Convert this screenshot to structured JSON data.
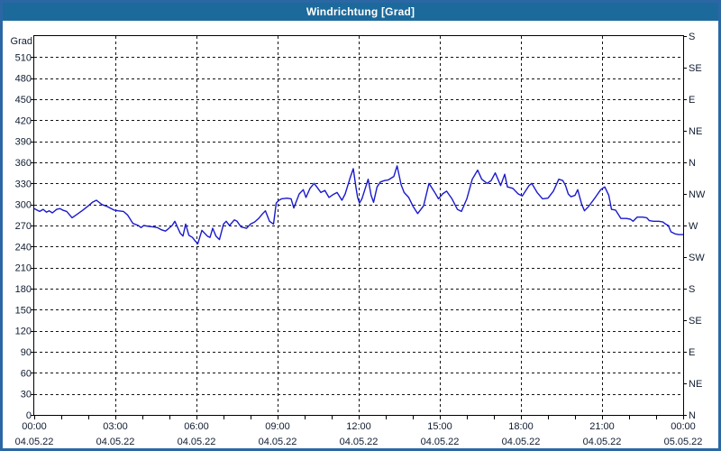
{
  "window": {
    "title": "Windrichtung [Grad]"
  },
  "colors": {
    "titlebar_bg": "#1c6a9c",
    "titlebar_text": "#ffffff",
    "frame": "#2b67a5",
    "background": "#ffffff",
    "plot_border": "#000000",
    "grid": "#141414",
    "axis_text": "#101c30",
    "line": "#1a1acc"
  },
  "chart_data": {
    "type": "line",
    "title": "Windrichtung [Grad]",
    "ylabel": "Grad",
    "ylim": [
      0,
      540
    ],
    "xlim_hours": [
      0,
      24
    ],
    "grid": "dashed",
    "y_ticks": [
      0,
      30,
      60,
      90,
      120,
      150,
      180,
      210,
      240,
      270,
      300,
      330,
      360,
      390,
      420,
      450,
      480,
      510
    ],
    "right_ticks": [
      {
        "value": 0,
        "label": "N"
      },
      {
        "value": 45,
        "label": "NE"
      },
      {
        "value": 90,
        "label": "E"
      },
      {
        "value": 135,
        "label": "SE"
      },
      {
        "value": 180,
        "label": "S"
      },
      {
        "value": 225,
        "label": "SW"
      },
      {
        "value": 270,
        "label": "W"
      },
      {
        "value": 315,
        "label": "NW"
      },
      {
        "value": 360,
        "label": "N"
      },
      {
        "value": 405,
        "label": "NE"
      },
      {
        "value": 450,
        "label": "E"
      },
      {
        "value": 495,
        "label": "SE"
      },
      {
        "value": 540,
        "label": "S"
      }
    ],
    "x_ticks": [
      {
        "hour": 0,
        "time": "00:00",
        "date": "04.05.22"
      },
      {
        "hour": 3,
        "time": "03:00",
        "date": "04.05.22"
      },
      {
        "hour": 6,
        "time": "06:00",
        "date": "04.05.22"
      },
      {
        "hour": 9,
        "time": "09:00",
        "date": "04.05.22"
      },
      {
        "hour": 12,
        "time": "12:00",
        "date": "04.05.22"
      },
      {
        "hour": 15,
        "time": "15:00",
        "date": "04.05.22"
      },
      {
        "hour": 18,
        "time": "18:00",
        "date": "04.05.22"
      },
      {
        "hour": 21,
        "time": "21:00",
        "date": "04.05.22"
      },
      {
        "hour": 24,
        "time": "00:00",
        "date": "05.05.22"
      }
    ],
    "minor_x_tick_hours": 1,
    "series": [
      {
        "name": "Windrichtung",
        "points": [
          [
            0,
            294
          ],
          [
            0.1,
            292
          ],
          [
            0.2,
            290
          ],
          [
            0.33,
            293
          ],
          [
            0.45,
            289
          ],
          [
            0.55,
            291
          ],
          [
            0.67,
            288
          ],
          [
            0.83,
            293
          ],
          [
            0.95,
            294
          ],
          [
            1.05,
            292
          ],
          [
            1.2,
            290
          ],
          [
            1.4,
            281
          ],
          [
            1.55,
            285
          ],
          [
            1.8,
            292
          ],
          [
            2,
            298
          ],
          [
            2.15,
            303
          ],
          [
            2.3,
            306
          ],
          [
            2.5,
            300
          ],
          [
            2.7,
            297
          ],
          [
            2.95,
            292
          ],
          [
            3.1,
            291
          ],
          [
            3.3,
            290
          ],
          [
            3.45,
            285
          ],
          [
            3.65,
            273
          ],
          [
            3.85,
            270
          ],
          [
            3.95,
            267
          ],
          [
            4.05,
            270
          ],
          [
            4.2,
            269
          ],
          [
            4.4,
            268
          ],
          [
            4.55,
            267
          ],
          [
            4.7,
            264
          ],
          [
            4.85,
            262
          ],
          [
            4.95,
            265
          ],
          [
            5.1,
            270
          ],
          [
            5.2,
            276
          ],
          [
            5.4,
            259
          ],
          [
            5.5,
            255
          ],
          [
            5.6,
            272
          ],
          [
            5.72,
            256
          ],
          [
            5.85,
            253
          ],
          [
            5.95,
            248
          ],
          [
            6.05,
            244
          ],
          [
            6.2,
            263
          ],
          [
            6.4,
            255
          ],
          [
            6.5,
            253
          ],
          [
            6.6,
            266
          ],
          [
            6.72,
            255
          ],
          [
            6.85,
            250
          ],
          [
            7,
            272
          ],
          [
            7.1,
            276
          ],
          [
            7.22,
            270
          ],
          [
            7.4,
            278
          ],
          [
            7.5,
            276
          ],
          [
            7.65,
            268
          ],
          [
            7.85,
            266
          ],
          [
            8,
            272
          ],
          [
            8.15,
            275
          ],
          [
            8.3,
            280
          ],
          [
            8.45,
            287
          ],
          [
            8.55,
            291
          ],
          [
            8.7,
            276
          ],
          [
            8.85,
            272
          ],
          [
            8.95,
            302
          ],
          [
            9.05,
            306
          ],
          [
            9.15,
            308
          ],
          [
            9.35,
            309
          ],
          [
            9.5,
            308
          ],
          [
            9.6,
            295
          ],
          [
            9.8,
            315
          ],
          [
            9.95,
            321
          ],
          [
            10.05,
            310
          ],
          [
            10.2,
            323
          ],
          [
            10.35,
            330
          ],
          [
            10.45,
            325
          ],
          [
            10.6,
            317
          ],
          [
            10.75,
            320
          ],
          [
            10.9,
            310
          ],
          [
            11.05,
            314
          ],
          [
            11.2,
            317
          ],
          [
            11.38,
            306
          ],
          [
            11.5,
            315
          ],
          [
            11.62,
            330
          ],
          [
            11.7,
            340
          ],
          [
            11.8,
            351
          ],
          [
            11.9,
            324
          ],
          [
            11.96,
            310
          ],
          [
            12.03,
            302
          ],
          [
            12.12,
            308
          ],
          [
            12.35,
            336
          ],
          [
            12.46,
            313
          ],
          [
            12.55,
            303
          ],
          [
            12.68,
            325
          ],
          [
            12.8,
            332
          ],
          [
            12.95,
            334
          ],
          [
            13.1,
            335
          ],
          [
            13.3,
            340
          ],
          [
            13.42,
            355
          ],
          [
            13.57,
            328
          ],
          [
            13.68,
            317
          ],
          [
            13.85,
            310
          ],
          [
            14,
            298
          ],
          [
            14.18,
            287
          ],
          [
            14.4,
            298
          ],
          [
            14.6,
            330
          ],
          [
            14.8,
            318
          ],
          [
            14.95,
            308
          ],
          [
            15.1,
            315
          ],
          [
            15.25,
            319
          ],
          [
            15.45,
            308
          ],
          [
            15.65,
            293
          ],
          [
            15.8,
            290
          ],
          [
            16,
            308
          ],
          [
            16.2,
            336
          ],
          [
            16.4,
            349
          ],
          [
            16.55,
            336
          ],
          [
            16.75,
            330
          ],
          [
            16.9,
            334
          ],
          [
            17.05,
            345
          ],
          [
            17.25,
            327
          ],
          [
            17.4,
            343
          ],
          [
            17.5,
            325
          ],
          [
            17.7,
            323
          ],
          [
            17.9,
            315
          ],
          [
            18.05,
            312
          ],
          [
            18.3,
            327
          ],
          [
            18.4,
            330
          ],
          [
            18.6,
            317
          ],
          [
            18.8,
            308
          ],
          [
            19,
            309
          ],
          [
            19.2,
            319
          ],
          [
            19.4,
            336
          ],
          [
            19.55,
            334
          ],
          [
            19.65,
            327
          ],
          [
            19.75,
            315
          ],
          [
            19.85,
            311
          ],
          [
            20,
            313
          ],
          [
            20.1,
            321
          ],
          [
            20.25,
            300
          ],
          [
            20.35,
            291
          ],
          [
            20.5,
            297
          ],
          [
            20.75,
            310
          ],
          [
            20.95,
            321
          ],
          [
            21.1,
            325
          ],
          [
            21.25,
            313
          ],
          [
            21.35,
            293
          ],
          [
            21.5,
            292
          ],
          [
            21.7,
            280
          ],
          [
            21.9,
            280
          ],
          [
            22.05,
            279
          ],
          [
            22.15,
            276
          ],
          [
            22.3,
            282
          ],
          [
            22.5,
            282
          ],
          [
            22.65,
            281
          ],
          [
            22.75,
            277
          ],
          [
            22.9,
            276
          ],
          [
            23.1,
            276
          ],
          [
            23.25,
            275
          ],
          [
            23.35,
            272
          ],
          [
            23.45,
            270
          ],
          [
            23.55,
            261
          ],
          [
            23.7,
            258
          ],
          [
            23.85,
            257
          ],
          [
            24,
            257
          ]
        ]
      }
    ]
  }
}
